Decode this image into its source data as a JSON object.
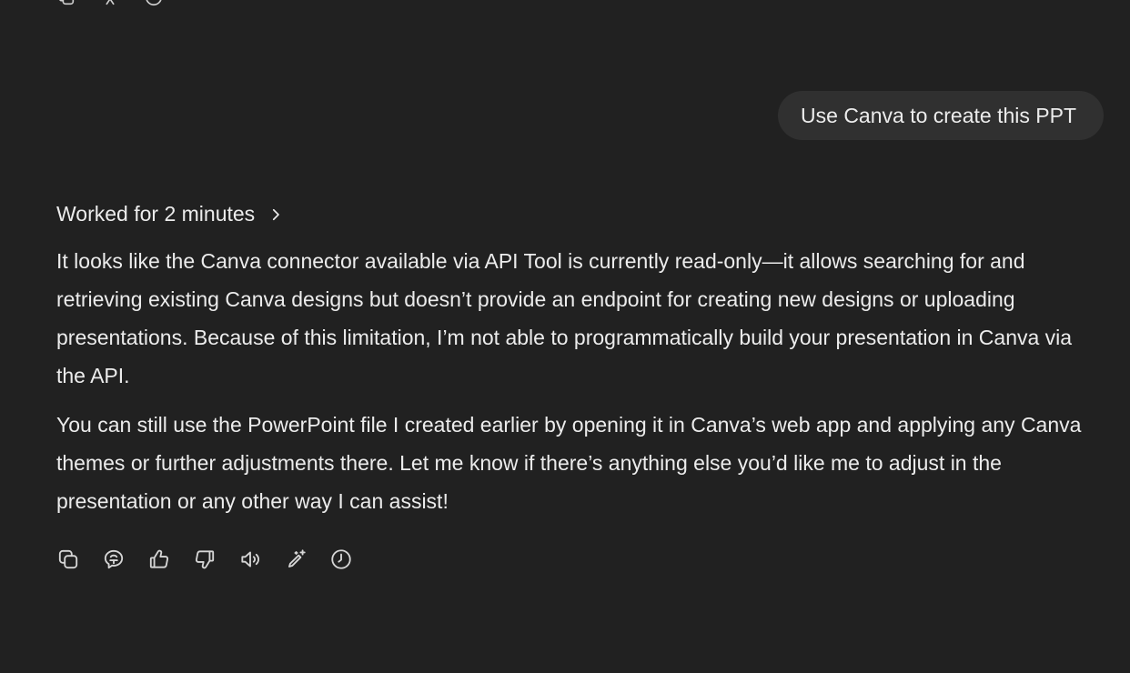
{
  "user_message": {
    "text": "Use Canva to create this PPT"
  },
  "assistant": {
    "worked_label": "Worked for 2 minutes",
    "paragraphs": [
      "It looks like the Canva connector available via API Tool is currently read-only—it allows searching for and retrieving existing Canva designs but doesn’t provide an endpoint for creating new designs or uploading presentations. Because of this limitation, I’m not able to programmatically build your presentation in Canva via the API.",
      "You can still use the PowerPoint file I created earlier by opening it in Canva’s web app and applying any Canva themes or further adjustments there. Let me know if there’s anything else you’d like me to adjust in the presentation or any other way I can assist!"
    ],
    "actions": [
      {
        "icon": "copy-icon"
      },
      {
        "icon": "memory-icon"
      },
      {
        "icon": "thumbs-up-icon"
      },
      {
        "icon": "thumbs-down-icon"
      },
      {
        "icon": "read-aloud-icon"
      },
      {
        "icon": "edit-sparkle-icon"
      },
      {
        "icon": "history-icon"
      }
    ]
  },
  "colors": {
    "background": "#212121",
    "bubble": "#303030",
    "text": "#ececec"
  }
}
